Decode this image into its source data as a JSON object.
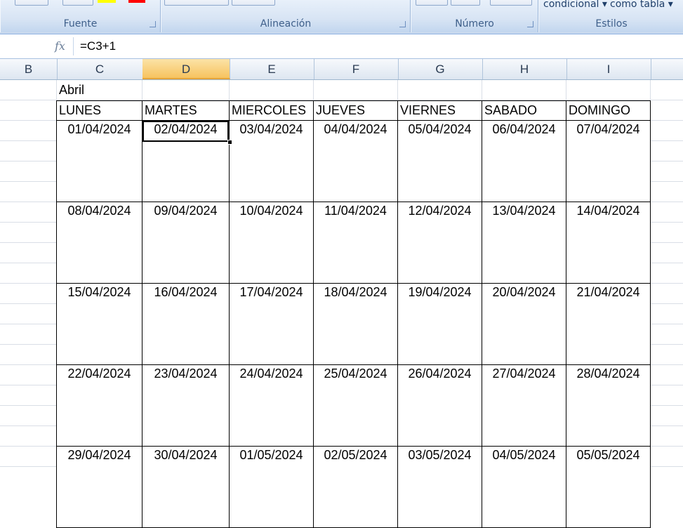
{
  "ribbon": {
    "groups": [
      {
        "name": "fuente",
        "label": "Fuente"
      },
      {
        "name": "alineacion",
        "label": "Alineación"
      },
      {
        "name": "numero",
        "label": "Número"
      },
      {
        "name": "estilos",
        "label": "Estilos"
      }
    ],
    "styles_buttons": {
      "conditional": "condicional",
      "as_table": "como tabla"
    },
    "colors": {
      "highlight": "#ffff00",
      "font_color": "#ff0000"
    }
  },
  "formula_bar": {
    "fx_icon": "fx-icon",
    "value": "=C3+1"
  },
  "columns": [
    "B",
    "C",
    "D",
    "E",
    "F",
    "G",
    "H",
    "I"
  ],
  "selected_column": "D",
  "sheet": {
    "month_title": "Abril",
    "weekdays": [
      "LUNES",
      "MARTES",
      "MIERCOLES",
      "JUEVES",
      "VIERNES",
      "SABADO",
      "DOMINGO"
    ],
    "weeks": [
      [
        "01/04/2024",
        "02/04/2024",
        "03/04/2024",
        "04/04/2024",
        "05/04/2024",
        "06/04/2024",
        "07/04/2024"
      ],
      [
        "08/04/2024",
        "09/04/2024",
        "10/04/2024",
        "11/04/2024",
        "12/04/2024",
        "13/04/2024",
        "14/04/2024"
      ],
      [
        "15/04/2024",
        "16/04/2024",
        "17/04/2024",
        "18/04/2024",
        "19/04/2024",
        "20/04/2024",
        "21/04/2024"
      ],
      [
        "22/04/2024",
        "23/04/2024",
        "24/04/2024",
        "25/04/2024",
        "26/04/2024",
        "27/04/2024",
        "28/04/2024"
      ],
      [
        "29/04/2024",
        "30/04/2024",
        "01/05/2024",
        "02/05/2024",
        "03/05/2024",
        "04/05/2024",
        "05/05/2024"
      ]
    ],
    "active_cell": {
      "week": 0,
      "day": 1
    }
  }
}
